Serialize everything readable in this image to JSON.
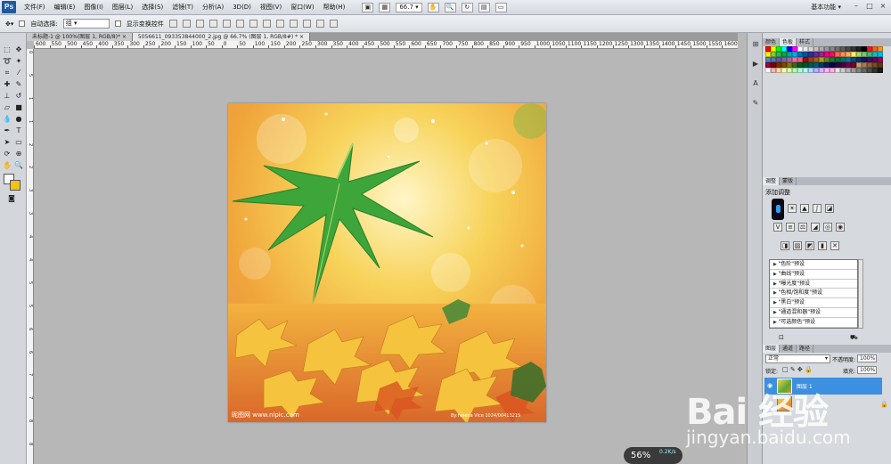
{
  "app": {
    "logo": "Ps"
  },
  "menu": [
    "文件(F)",
    "编辑(E)",
    "图像(I)",
    "图层(L)",
    "选择(S)",
    "滤镜(T)",
    "分析(A)",
    "3D(D)",
    "视图(V)",
    "窗口(W)",
    "帮助(H)"
  ],
  "zoom": "66.7",
  "workspace": "基本功能",
  "window_controls": [
    "–",
    "□",
    "×"
  ],
  "options": {
    "auto_select_label": "自动选择:",
    "auto_select_value": "组",
    "show_transform_label": "显示变换控件"
  },
  "tabs": [
    {
      "label": "未标题-1 @ 100%(图层 1, RGB/8)* ×",
      "active": false
    },
    {
      "label": "5056611_093353844000_2.jpg @ 66.7% (图层 1, RGB/8#) * ×",
      "active": true
    }
  ],
  "ruler": {
    "h": [
      "600",
      "550",
      "500",
      "450",
      "400",
      "350",
      "300",
      "250",
      "200",
      "150",
      "100",
      "50",
      "0",
      "50",
      "100",
      "150",
      "200",
      "250",
      "300",
      "350",
      "400",
      "450",
      "500",
      "550",
      "600",
      "650",
      "700",
      "750",
      "800",
      "850",
      "900",
      "950",
      "1000",
      "1050",
      "1100",
      "1150",
      "1200",
      "1250",
      "1300",
      "1350",
      "1400",
      "1450",
      "1500",
      "1550",
      "1600"
    ],
    "v": [
      "0",
      "5",
      "1",
      "1",
      "2",
      "2",
      "3",
      "3",
      "4",
      "4",
      "5",
      "5",
      "6",
      "6",
      "7",
      "7",
      "8",
      "8"
    ]
  },
  "color_panel": {
    "tabs": [
      "颜色",
      "色板",
      "样式"
    ]
  },
  "adjust_panel": {
    "tabs": [
      "调整",
      "蒙版"
    ],
    "title": "添加调整",
    "presets": [
      "\"色阶\"预设",
      "\"曲线\"预设",
      "\"曝光度\"预设",
      "\"色相/饱和度\"预设",
      "\"黑白\"预设",
      "\"通道混和器\"预设",
      "\"可选颜色\"预设"
    ]
  },
  "layers_panel": {
    "tabs": [
      "图层",
      "通道",
      "路径"
    ],
    "blend_mode": "正常",
    "opacity_label": "不透明度:",
    "opacity_value": "100%",
    "lock_label": "锁定:",
    "fill_label": "填充:",
    "fill_value": "100%",
    "layer1_name": "图层 1"
  },
  "image": {
    "caption_left": "昵图网 www.nipic.com",
    "caption_right": "By:helena Vice 1024/00413215"
  },
  "status": {
    "percent": "56%",
    "rate": "0.2K/s"
  },
  "watermark": {
    "logo": "Bai 经验",
    "url": "jingyan.baidu.com"
  },
  "colors": {
    "ps_blue": "#1d5a9e",
    "layer_selected": "#3d8fe0",
    "canvas_bg": "#b7b7b7",
    "foreground": "#ffffff",
    "background": "#f2c313"
  }
}
